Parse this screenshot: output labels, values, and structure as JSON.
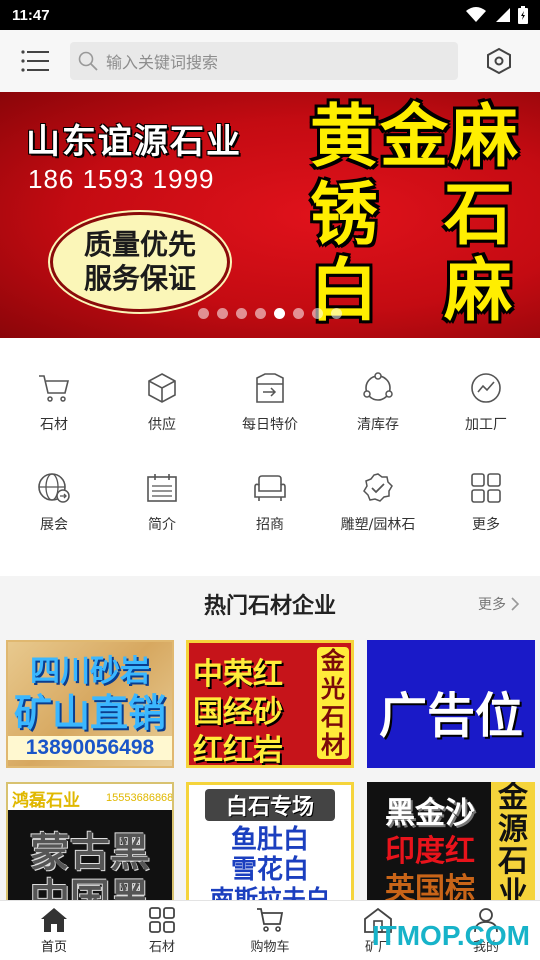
{
  "status_bar": {
    "time": "11:47",
    "icons": [
      "wifi-icon",
      "signal-icon",
      "battery-icon"
    ]
  },
  "header": {
    "search": {
      "placeholder": "输入关键词搜索"
    },
    "icons": [
      "menu-icon",
      "search-icon",
      "hexagon-settings-icon"
    ]
  },
  "banner": {
    "company": "山东谊源石业",
    "phone": "186 1593 1999",
    "slogan_line1": "质量优先",
    "slogan_line2": "服务保证",
    "big_row1": "黄金麻",
    "big_row2_left": "锈",
    "big_row2_right": "石",
    "big_row3_left": "白",
    "big_row3_right": "麻",
    "slide_count": 8,
    "active_slide": 5,
    "bg_color": "#d10f17",
    "accent_color": "#ffee00"
  },
  "grid_menu": {
    "items": [
      {
        "label": "石材",
        "icon": "cart-icon"
      },
      {
        "label": "供应",
        "icon": "box-icon"
      },
      {
        "label": "每日特价",
        "icon": "price-tag-icon"
      },
      {
        "label": "清库存",
        "icon": "network-icon"
      },
      {
        "label": "加工厂",
        "icon": "chart-circle-icon"
      },
      {
        "label": "展会",
        "icon": "globe-icon"
      },
      {
        "label": "简介",
        "icon": "calendar-icon"
      },
      {
        "label": "招商",
        "icon": "sofa-icon"
      },
      {
        "label": "雕塑/园林石",
        "icon": "badge-check-icon"
      },
      {
        "label": "更多",
        "icon": "grid-icon"
      }
    ]
  },
  "section": {
    "title": "热门石材企业",
    "more_label": "更多"
  },
  "tiles": [
    {
      "line1": "四川砂岩",
      "line2": "矿山直销",
      "line3": "13890056498"
    },
    {
      "line1": "中荣红",
      "line2": "国经砂",
      "line3": "红红岩",
      "side": "金光石材"
    },
    {
      "line1": "广告位"
    },
    {
      "header": "鸿磊石业",
      "phone": "15553686868",
      "line1": "蒙古黑",
      "line2": "中国黑"
    },
    {
      "header": "白石专场",
      "line1": "鱼肚白",
      "line2": "雪花白",
      "line3": "南斯拉夫白"
    },
    {
      "line1": "黑金沙",
      "line2": "印度红",
      "line3": "英国棕",
      "side": "金源石业"
    }
  ],
  "tab_bar": {
    "items": [
      {
        "label": "首页",
        "icon": "home-icon",
        "active": true
      },
      {
        "label": "石材",
        "icon": "grid-icon",
        "active": false
      },
      {
        "label": "购物车",
        "icon": "shopping-cart-icon",
        "active": false
      },
      {
        "label": "矿厂",
        "icon": "factory-icon",
        "active": false
      },
      {
        "label": "我的",
        "icon": "user-icon",
        "active": false
      }
    ]
  },
  "watermark": "ITMOP.COM"
}
